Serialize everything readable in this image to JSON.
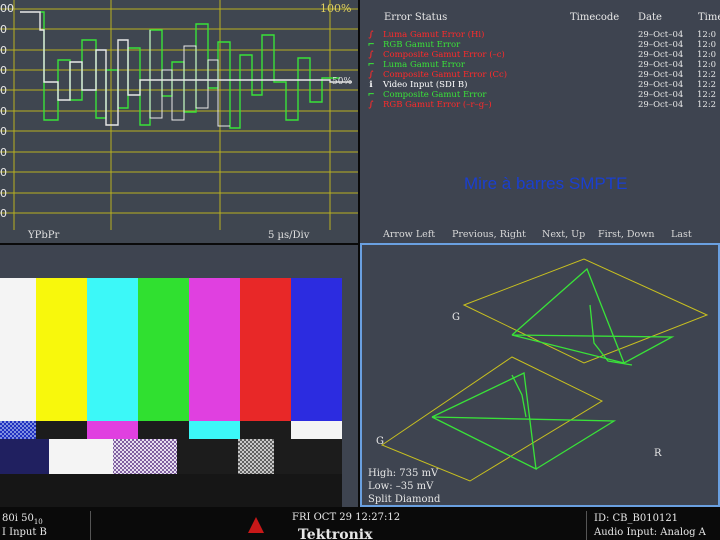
{
  "waveform": {
    "top_label": "100%",
    "marker_label": "50%",
    "y_ticks": [
      "00",
      "0",
      "0",
      "0",
      "0",
      "0",
      "0",
      "0",
      "0",
      "0",
      "0",
      "0"
    ],
    "format_label": "YPbPr",
    "scale_label": "5 µs/Div"
  },
  "error_status": {
    "headers": {
      "status": "Error Status",
      "timecode": "Timecode",
      "date": "Date",
      "time": "Time"
    },
    "rows": [
      {
        "icon": "∫",
        "color": "#ff2a2a",
        "message": "Luma Gamut Error (Hi)",
        "date": "29–Oct–04",
        "time": "12:0"
      },
      {
        "icon": "⌐",
        "color": "#39e239",
        "message": "RGB Gamut Error",
        "date": "29–Oct–04",
        "time": "12:0"
      },
      {
        "icon": "∫",
        "color": "#ff2a2a",
        "message": "Composite Gamut Error (–c)",
        "date": "29–Oct–04",
        "time": "12:0"
      },
      {
        "icon": "⌐",
        "color": "#39e239",
        "message": "Luma Gamut Error",
        "date": "29–Oct–04",
        "time": "12:0"
      },
      {
        "icon": "∫",
        "color": "#ff2a2a",
        "message": "Composite Gamut Error (Cc)",
        "date": "29–Oct–04",
        "time": "12:2"
      },
      {
        "icon": "i",
        "color": "#ffffff",
        "message": "Video Input (SDI B)",
        "date": "29–Oct–04",
        "time": "12:2"
      },
      {
        "icon": "⌐",
        "color": "#39e239",
        "message": "Composite Gamut Error",
        "date": "29–Oct–04",
        "time": "12:2"
      },
      {
        "icon": "∫",
        "color": "#ff2a2a",
        "message": "RGB Gamut Error (–r–g–)",
        "date": "29–Oct–04",
        "time": "12:2"
      }
    ],
    "overlay_title": "Mire à barres SMPTE",
    "nav": [
      "Arrow Left",
      "Previous, Right",
      "Next, Up",
      "First, Down",
      "Last"
    ]
  },
  "vector": {
    "label_g_top": "G",
    "label_g_bottom": "G",
    "label_r": "R",
    "readouts": [
      "High: 735 mV",
      "Low: –35 mV",
      "Split Diamond"
    ]
  },
  "bottom": {
    "format": "80i 50",
    "format_sub": "10",
    "input": "I Input B",
    "datetime": "FRI OCT 29  12:27:12",
    "brand": "Tektronix",
    "id": "ID: CB_B010121",
    "audio": "Audio Input: Analog A"
  },
  "colors": {
    "trace_green": "#39e239",
    "trace_white": "#e8e8e8",
    "grid_yellow": "#b8b020",
    "pane_bg": "#3e4450",
    "accent_blue": "#6aa0e0"
  }
}
